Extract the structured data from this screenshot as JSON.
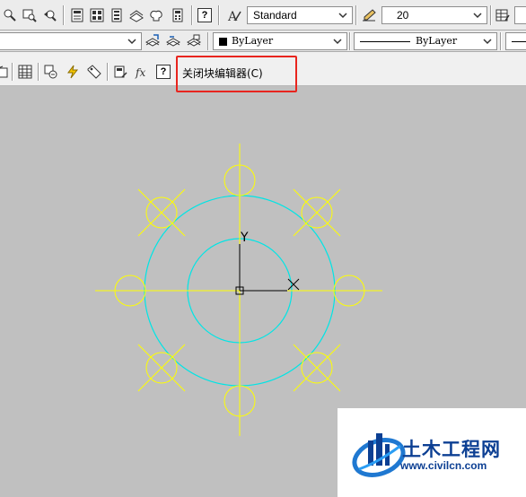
{
  "toolbar_top": {
    "text_style": "Standard",
    "dim_value": "20"
  },
  "toolbar_layers": {
    "color": "ByLayer",
    "linetype": "ByLayer"
  },
  "block_editor": {
    "close_label": "关闭块编辑器(C)"
  },
  "drawing": {
    "y_label": "Y",
    "accent_yellow": "#ffff00",
    "accent_cyan": "#00e5e5",
    "highlight_color": "#e8251e"
  },
  "watermark": {
    "title": "土木工程网",
    "url": "www.civilcn.com"
  }
}
